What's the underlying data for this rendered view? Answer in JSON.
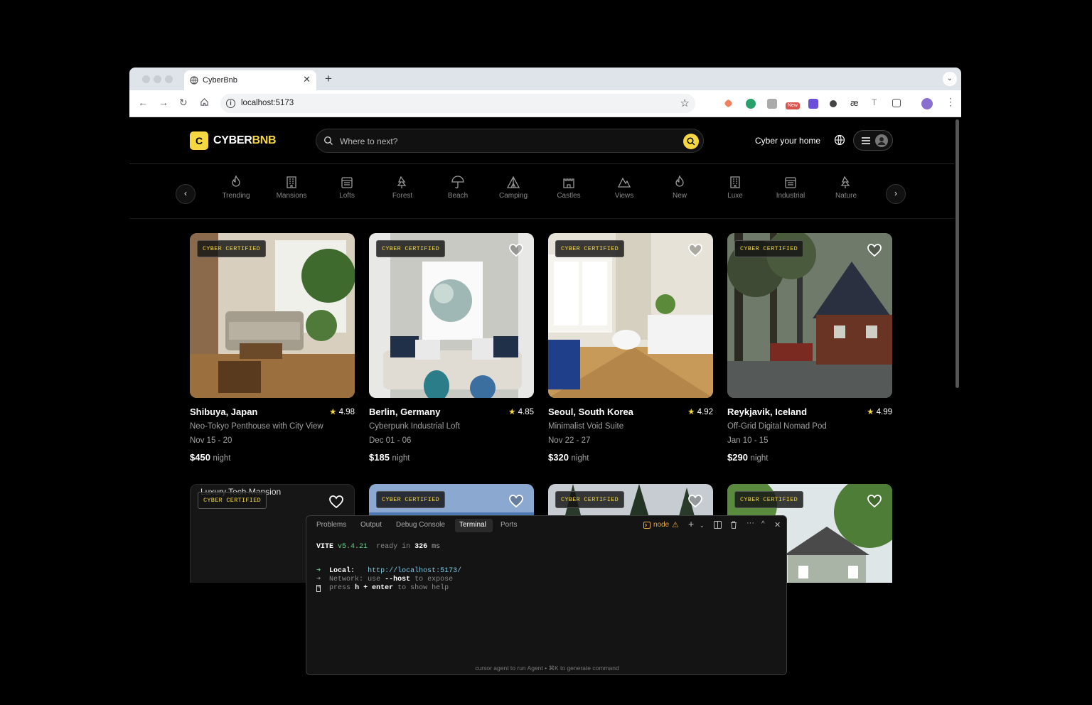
{
  "browser": {
    "tab_title": "CyberBnb",
    "new_tab_label": "+",
    "close_label": "✕",
    "url": "localhost:5173",
    "ext_new_badge": "New"
  },
  "site": {
    "logo_mark": "C",
    "logo_primary": "CYBER",
    "logo_accent": "BNB",
    "search_placeholder": "Where to next?",
    "host_link": "Cyber your home"
  },
  "categories": [
    {
      "label": "Trending",
      "icon": "flame-icon"
    },
    {
      "label": "Mansions",
      "icon": "building-icon"
    },
    {
      "label": "Lofts",
      "icon": "loft-icon"
    },
    {
      "label": "Forest",
      "icon": "tree-icon"
    },
    {
      "label": "Beach",
      "icon": "umbrella-icon"
    },
    {
      "label": "Camping",
      "icon": "tent-icon"
    },
    {
      "label": "Castles",
      "icon": "castle-icon"
    },
    {
      "label": "Views",
      "icon": "mountain-icon"
    },
    {
      "label": "New",
      "icon": "flame-icon"
    },
    {
      "label": "Luxe",
      "icon": "building-icon"
    },
    {
      "label": "Industrial",
      "icon": "loft-icon"
    },
    {
      "label": "Nature",
      "icon": "tree-icon"
    }
  ],
  "badge_label": "CYBER CERTIFIED",
  "listings": [
    {
      "location": "Shibuya, Japan",
      "rating": "4.98",
      "title": "Neo-Tokyo Penthouse with City View",
      "dates": "Nov 15 - 20",
      "price": "$450",
      "unit": "night"
    },
    {
      "location": "Berlin, Germany",
      "rating": "4.85",
      "title": "Cyberpunk Industrial Loft",
      "dates": "Dec 01 - 06",
      "price": "$185",
      "unit": "night"
    },
    {
      "location": "Seoul, South Korea",
      "rating": "4.92",
      "title": "Minimalist Void Suite",
      "dates": "Nov 22 - 27",
      "price": "$320",
      "unit": "night"
    },
    {
      "location": "Reykjavik, Iceland",
      "rating": "4.99",
      "title": "Off-Grid Digital Nomad Pod",
      "dates": "Jan 10 - 15",
      "price": "$290",
      "unit": "night"
    }
  ],
  "second_row": {
    "broken_image_alt": "Luxury Tech Mansion"
  },
  "terminal": {
    "tabs": [
      "Problems",
      "Output",
      "Debug Console",
      "Terminal",
      "Ports"
    ],
    "active_tab": "Terminal",
    "process": "node",
    "vite_name": "VITE",
    "vite_version": "v5.4.21",
    "ready_text": "ready in",
    "ready_ms": "326",
    "ready_unit": "ms",
    "local_label": "Local:",
    "local_url": "http://localhost:5173/",
    "network_label": "Network:",
    "network_text": "use",
    "network_flag": "--host",
    "network_tail": "to expose",
    "help_pre": "press",
    "help_key": "h + enter",
    "help_tail": "to show help",
    "hint": "cursor  agent to run Agent • ⌘K to generate command"
  },
  "colors": {
    "accent": "#f5d742",
    "background": "#000000",
    "terminal_green": "#6bd089"
  }
}
